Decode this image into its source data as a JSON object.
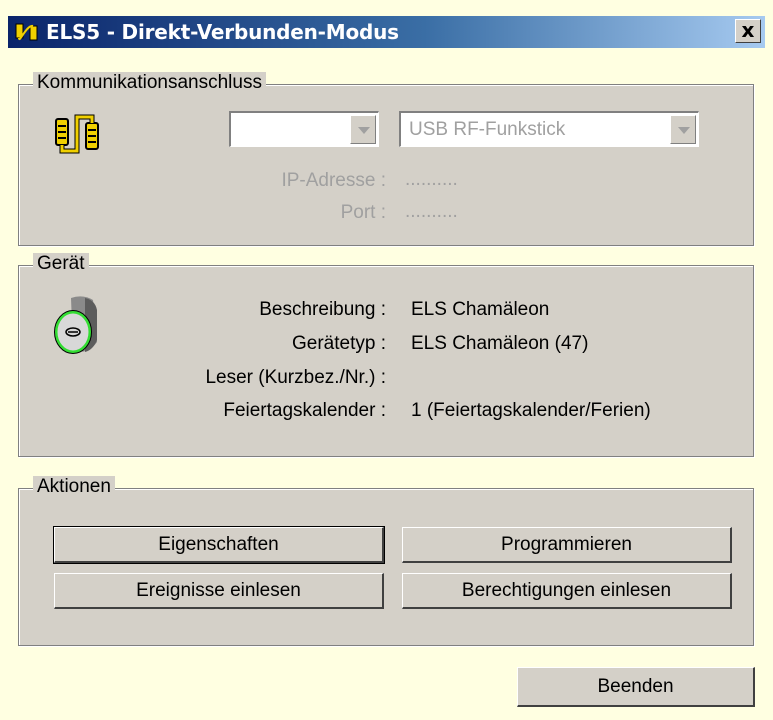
{
  "window": {
    "title": "ELS5 - Direkt-Verbunden-Modus",
    "close_glyph": "x"
  },
  "kommunikation": {
    "group_title": "Kommunikationsanschluss",
    "icon": "connection-cable-icon",
    "port_combo_value": "",
    "device_combo_value": "USB RF-Funkstick",
    "ip_label": "IP-Adresse :",
    "ip_value": "..........",
    "port_label": "Port :",
    "port_value": ".........."
  },
  "geraet": {
    "group_title": "Gerät",
    "icon": "reader-device-icon",
    "rows": [
      {
        "label": "Beschreibung :",
        "value": "ELS Chamäleon"
      },
      {
        "label": "Gerätetyp :",
        "value": "ELS Chamäleon (47)"
      },
      {
        "label": "Leser (Kurzbez./Nr.) :",
        "value": ""
      },
      {
        "label": "Feiertagskalender :",
        "value": "1 (Feiertagskalender/Ferien)"
      }
    ]
  },
  "aktionen": {
    "group_title": "Aktionen",
    "buttons": {
      "eigenschaften": "Eigenschaften",
      "programmieren": "Programmieren",
      "ereignisse": "Ereignisse einlesen",
      "berechtigungen": "Berechtigungen einlesen"
    }
  },
  "footer": {
    "beenden": "Beenden"
  },
  "colors": {
    "dialog_bg": "#ffffe1",
    "panel_bg": "#d4d0c8",
    "title_start": "#0a246a",
    "title_end": "#a6caf0",
    "icon_yellow": "#f0d000",
    "device_ring_green": "#22dd22"
  }
}
